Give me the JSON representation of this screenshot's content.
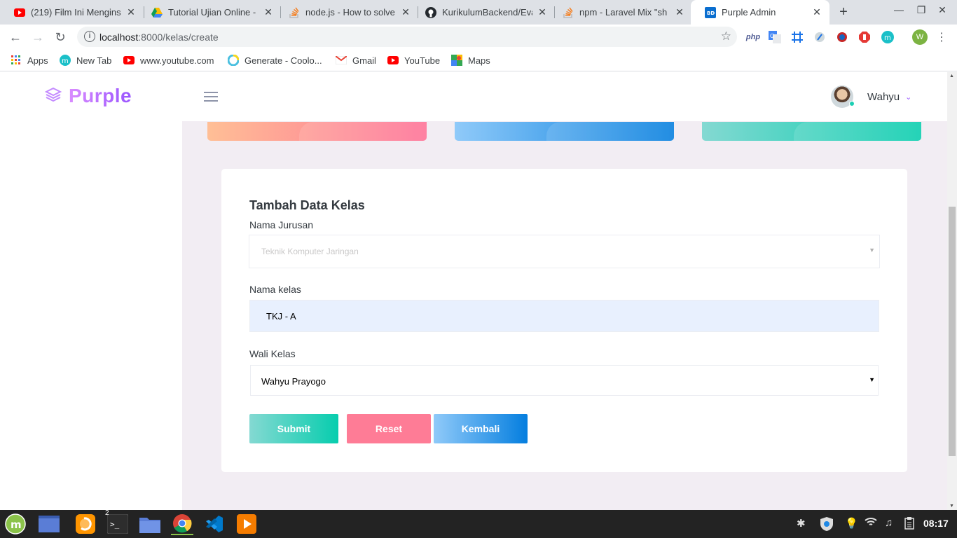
{
  "browser": {
    "tabs": [
      {
        "title": "(219) Film Ini Menginsp",
        "icon": "youtube-icon",
        "active": false
      },
      {
        "title": "Tutorial Ujian Online - (",
        "icon": "google-drive-icon",
        "active": false
      },
      {
        "title": "node.js - How to solve",
        "icon": "stackoverflow-icon",
        "active": false
      },
      {
        "title": "KurikulumBackend/Eva",
        "icon": "github-icon",
        "active": false
      },
      {
        "title": "npm - Laravel Mix \"sh",
        "icon": "stackoverflow-icon",
        "active": false
      },
      {
        "title": "Purple Admin",
        "icon": "bootstrapdash-icon",
        "active": true
      }
    ],
    "url_host": "localhost",
    "url_path": ":8000/kelas/create",
    "bookmarks": [
      {
        "label": "Apps",
        "icon": "apps-grid-icon"
      },
      {
        "label": "New Tab",
        "icon": "newtab-icon"
      },
      {
        "label": "www.youtube.com",
        "icon": "youtube-icon"
      },
      {
        "label": "Generate - Coolo...",
        "icon": "coolors-icon"
      },
      {
        "label": "Gmail",
        "icon": "gmail-icon"
      },
      {
        "label": "YouTube",
        "icon": "youtube-icon"
      },
      {
        "label": "Maps",
        "icon": "maps-icon"
      }
    ],
    "profile_initial": "W"
  },
  "app": {
    "brand": "Purple",
    "user_name": "Wahyu"
  },
  "form": {
    "title": "Tambah Data Kelas",
    "jurusan_label": "Nama Jurusan",
    "jurusan_value": "Teknik Komputer Jaringan",
    "kelas_label": "Nama kelas",
    "kelas_value": "TKJ - A",
    "wali_label": "Wali Kelas",
    "wali_value": "Wahyu Prayogo",
    "submit_label": "Submit",
    "reset_label": "Reset",
    "back_label": "Kembali"
  },
  "taskbar": {
    "terminal_badge": "2",
    "clock": "08:17"
  },
  "colors": {
    "brand": "#b66dff",
    "submit": "#1bcfb4",
    "reset": "#fe7c96",
    "back": "#198ae3"
  }
}
